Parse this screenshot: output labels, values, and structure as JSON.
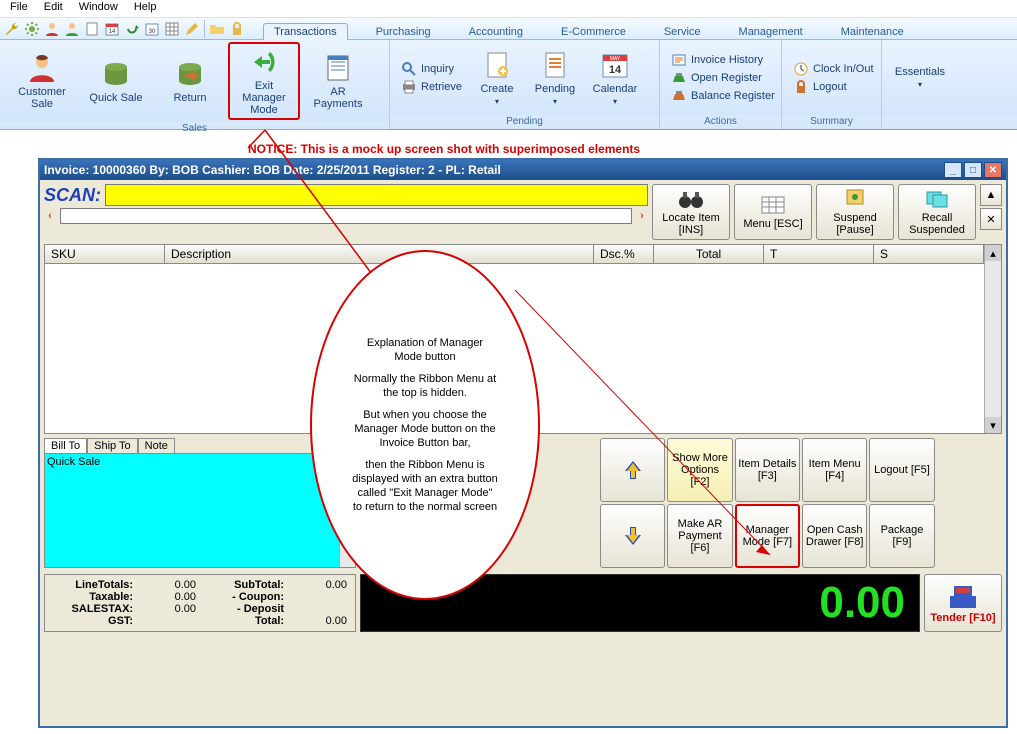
{
  "menubar": [
    "File",
    "Edit",
    "Window",
    "Help"
  ],
  "ribbon_tabs": [
    "Transactions",
    "Purchasing",
    "Accounting",
    "E-Commerce",
    "Service",
    "Management",
    "Maintenance"
  ],
  "active_tab": "Transactions",
  "ribbon": {
    "group_sales": {
      "caption": "Sales",
      "customer_sale": "Customer Sale",
      "quick_sale": "Quick Sale",
      "return": "Return",
      "exit_manager_mode": "Exit Manager Mode",
      "ar_payments": "AR Payments"
    },
    "group_pending": {
      "caption": "Pending",
      "inquiry": "Inquiry",
      "retrieve": "Retrieve",
      "create": "Create",
      "pending": "Pending",
      "calendar": "Calendar"
    },
    "group_actions": {
      "caption": "Actions",
      "invoice_history": "Invoice History",
      "open_register": "Open Register",
      "balance_register": "Balance Register"
    },
    "group_summary": {
      "caption": "Summary",
      "clock": "Clock In/Out",
      "logout": "Logout"
    },
    "essentials": "Essentials"
  },
  "notice": "NOTICE:   This is a mock up screen shot with superimposed elements",
  "pos": {
    "title": "Invoice: 10000360  By: BOB Cashier: BOB   Date:  2/25/2011  Register: 2 - PL: Retail",
    "scan_label": "SCAN:",
    "buttons": {
      "locate": "Locate Item [INS]",
      "menu": "Menu [ESC]",
      "suspend": "Suspend [Pause]",
      "recall": "Recall Suspended"
    },
    "grid_headers": {
      "sku": "SKU",
      "desc": "Description",
      "dscp": "Dsc.%",
      "total": "Total",
      "t": "T",
      "s": "S"
    },
    "minitabs": {
      "billto": "Bill To",
      "shipto": "Ship To",
      "note": "Note"
    },
    "quick_sale_label": "Quick Sale",
    "sq": {
      "show_more": "Show More Options [F2]",
      "item_details": "Item Details [F3]",
      "item_menu": "Item Menu [F4]",
      "logout": "Logout [F5]",
      "make_ar": "Make AR Payment [F6]",
      "manager_mode": "Manager Mode [F7]",
      "open_cash": "Open Cash Drawer [F8]",
      "package": "Package [F9]"
    },
    "totals": {
      "line_totals_k": "LineTotals:",
      "line_totals_v": "0.00",
      "taxable_k": "Taxable:",
      "taxable_v": "0.00",
      "salestax_k": "SALESTAX:",
      "salestax_v": "0.00",
      "gst_k": "GST:",
      "gst_v": "",
      "subtotal_k": "SubTotal:",
      "subtotal_v": "0.00",
      "coupon_k": "- Coupon:",
      "coupon_v": "",
      "deposit_k": "- Deposit",
      "deposit_v": "",
      "total_k": "Total:",
      "total_v": "0.00"
    },
    "big_total": "0.00",
    "tender": "Tender [F10]"
  },
  "annotation": {
    "title": "Explanation of Manager Mode button",
    "p1": "Normally the Ribbon Menu at the top is hidden.",
    "p2": "But when you choose the Manager Mode button on the Invoice Button bar,",
    "p3": "then the Ribbon Menu is displayed with an extra button called \"Exit Manager Mode\" to return to the normal screen"
  }
}
